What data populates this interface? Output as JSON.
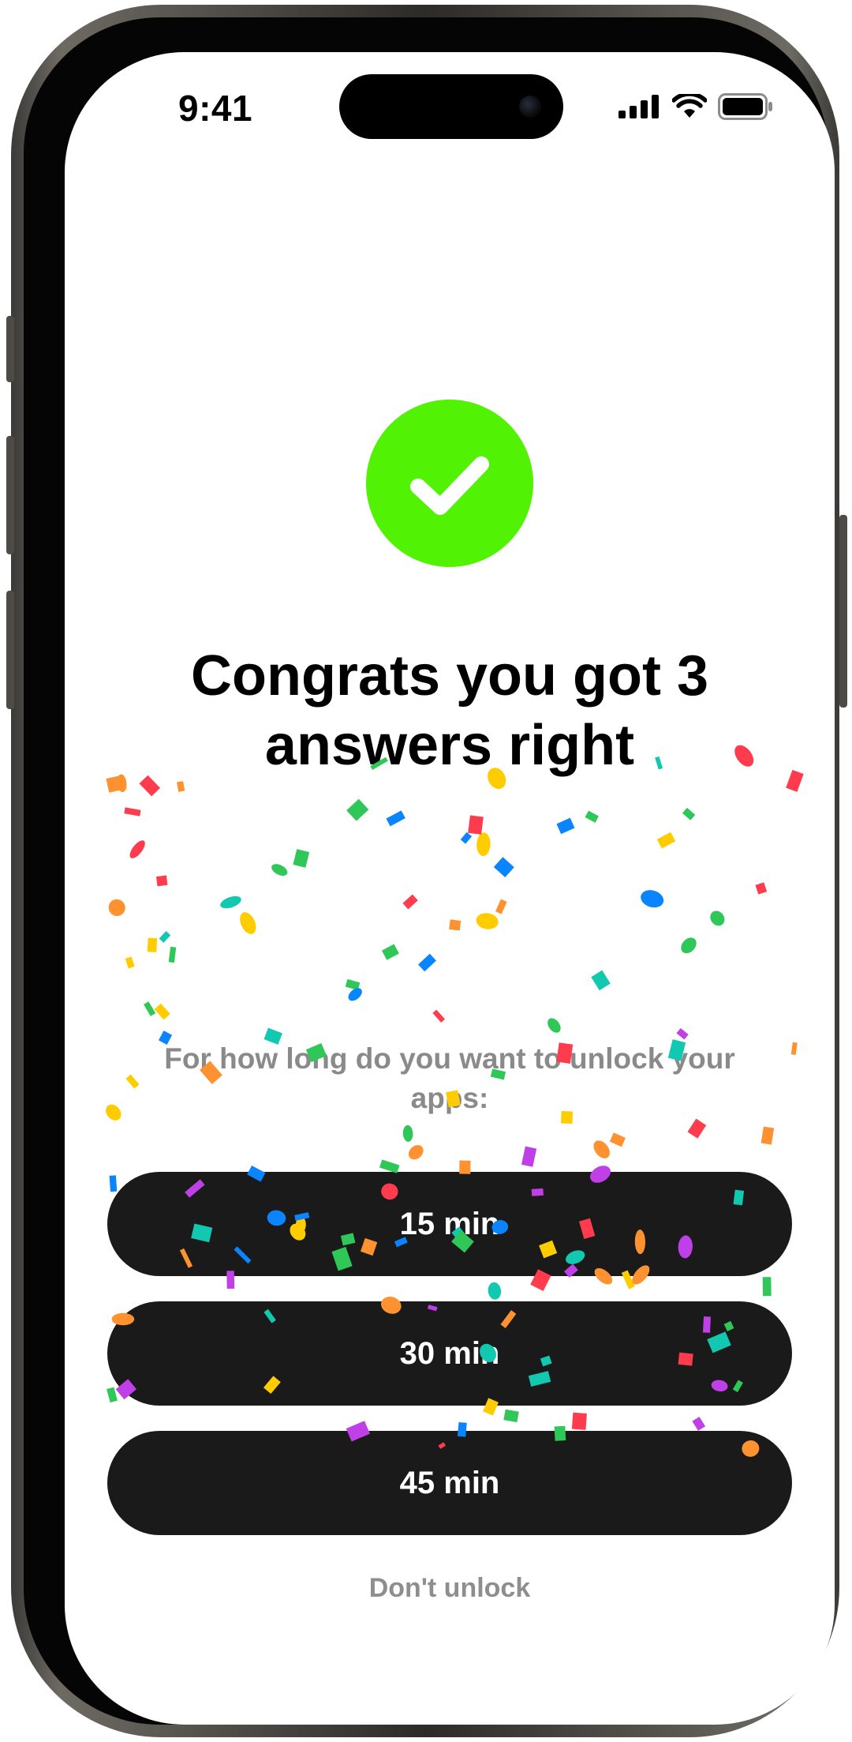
{
  "status_bar": {
    "time": "9:41"
  },
  "success": {
    "icon": "checkmark-icon",
    "color": "#52f205",
    "title": "Congrats you got 3 answers right"
  },
  "unlock": {
    "prompt": "For how long do you want to unlock your apps:",
    "options": [
      {
        "label": "15 min"
      },
      {
        "label": "30 min"
      },
      {
        "label": "45 min"
      }
    ],
    "decline_label": "Don't unlock"
  },
  "confetti_colors": [
    "#ff3b4e",
    "#0a84ff",
    "#30c759",
    "#ffcc00",
    "#ff9230",
    "#bf40e6",
    "#12c8b0"
  ]
}
